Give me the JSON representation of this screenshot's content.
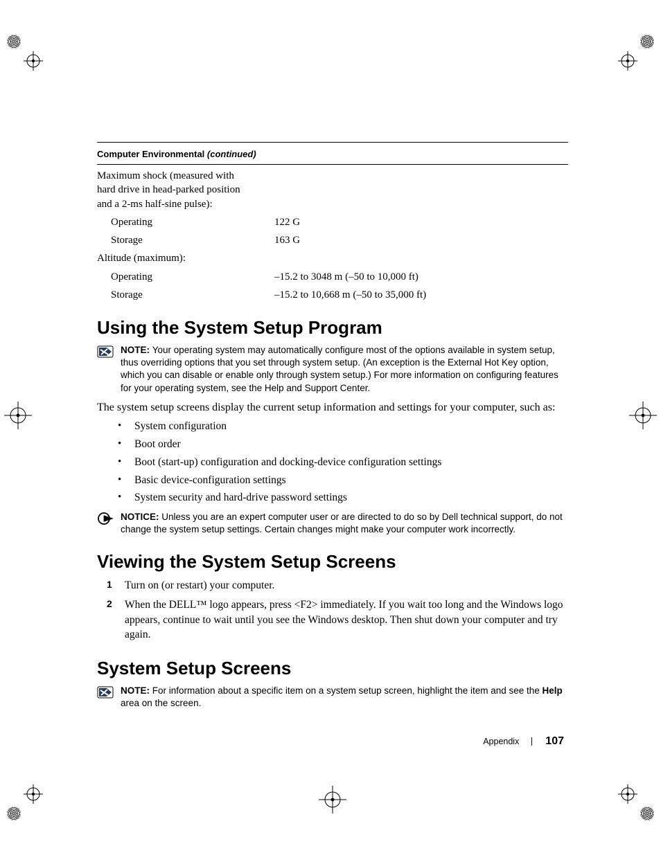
{
  "table": {
    "header_a": "Computer Environmental ",
    "header_b": "(continued)",
    "shock_label": "Maximum shock (measured with hard drive in head-parked position and a 2-ms half-sine pulse):",
    "shock_op_label": "Operating",
    "shock_op_val": "122 G",
    "shock_st_label": "Storage",
    "shock_st_val": "163 G",
    "alt_label": "Altitude (maximum):",
    "alt_op_label": "Operating",
    "alt_op_val": "–15.2 to 3048 m (–50 to 10,000 ft)",
    "alt_st_label": "Storage",
    "alt_st_val": "–15.2 to 10,668 m (–50 to 35,000 ft)"
  },
  "h1_using": "Using the System Setup Program",
  "note1": {
    "lead": "NOTE: ",
    "a": "Your operating system may automatically configure most of the options available in system setup, thus overriding options that you set through system setup. (An exception is the ",
    "hk": "External Hot Key",
    "b": " option, which you can disable or enable only through system setup.) For more information on configuring features for your operating system, see the Help and Support Center."
  },
  "para_intro": "The system setup screens display the current setup information and settings for your computer, such as:",
  "bullets": [
    "System configuration",
    "Boot order",
    "Boot (start-up) configuration and docking-device configuration settings",
    "Basic device-configuration settings",
    "System security and hard-drive password settings"
  ],
  "notice1": {
    "lead": "NOTICE: ",
    "text": "Unless you are an expert computer user or are directed to do so by Dell technical support, do not change the system setup settings. Certain changes might make your computer work incorrectly."
  },
  "h1_view": "Viewing the System Setup Screens",
  "steps": [
    "Turn on (or restart) your computer.",
    "When the DELL™ logo appears, press <F2> immediately. If you wait too long and the Windows logo appears, continue to wait until you see the Windows desktop. Then shut down your computer and try again."
  ],
  "step_nums": [
    "1",
    "2"
  ],
  "h1_screens": "System Setup Screens",
  "note2": {
    "lead": "NOTE: ",
    "a": "For information about a specific item on a system setup screen, highlight the item and see the ",
    "hk": "Help",
    "b": " area on the screen."
  },
  "footer": {
    "section": "Appendix",
    "page": "107"
  }
}
